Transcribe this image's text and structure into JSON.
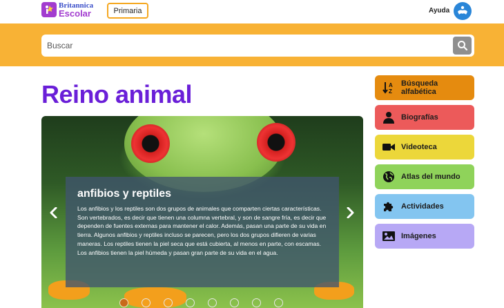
{
  "header": {
    "logo_top": "Britannica",
    "logo_bottom": "Escolar",
    "level_button": "Primaria",
    "help_label": "Ayuda"
  },
  "search": {
    "placeholder": "Buscar"
  },
  "page": {
    "title": "Reino animal"
  },
  "carousel": {
    "slide_title": "anfibios y reptiles",
    "slide_text": "Los anfibios y los reptiles son dos grupos de animales que comparten ciertas características. Son vertebrados, es decir que tienen una columna vertebral, y son de sangre fría, es decir que dependen de fuentes externas para mantener el calor. Además, pasan una parte de su vida en tierra. Algunos anfibios y reptiles incluso se parecen, pero los dos grupos difieren de varias maneras. Los reptiles tienen la piel seca que está cubierta, al menos en parte, con escamas. Los anfibios tienen la piel húmeda y pasan gran parte de su vida en el agua.",
    "slide_count": 8,
    "active_index": 0
  },
  "categories": [
    {
      "label": "Búsqueda alfabética",
      "icon": "sort-az-icon",
      "color": "#e58b0f"
    },
    {
      "label": "Biografías",
      "icon": "person-icon",
      "color": "#ec5a5a"
    },
    {
      "label": "Videoteca",
      "icon": "video-camera-icon",
      "color": "#ecd73a"
    },
    {
      "label": "Atlas del mundo",
      "icon": "globe-icon",
      "color": "#8fd35a"
    },
    {
      "label": "Actividades",
      "icon": "puzzle-icon",
      "color": "#83c5f0"
    },
    {
      "label": "Imágenes",
      "icon": "image-icon",
      "color": "#b7a8f5"
    }
  ],
  "colors": {
    "accent_orange": "#f8b235",
    "title_purple": "#6a1fd8"
  }
}
